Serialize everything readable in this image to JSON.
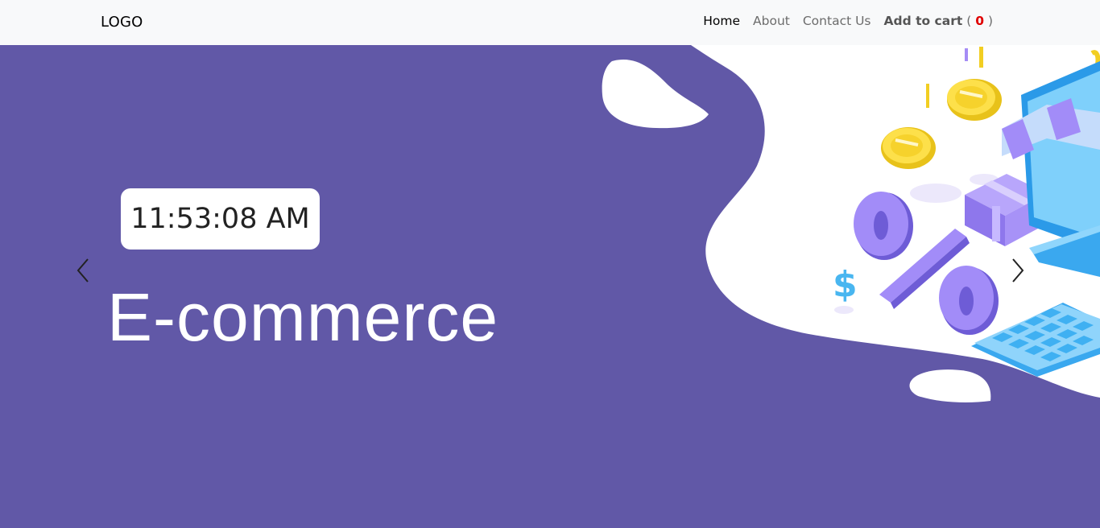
{
  "navbar": {
    "logo": "LOGO",
    "links": [
      {
        "label": "Home"
      },
      {
        "label": "About"
      },
      {
        "label": "Contact Us"
      }
    ],
    "cart": {
      "label": "Add to cart",
      "open": "(",
      "count": "0",
      "close": ")"
    }
  },
  "hero": {
    "clock": "11:53:08 AM",
    "title": "E-commerce",
    "prev_icon": "chevron-left-icon",
    "next_icon": "chevron-right-icon"
  },
  "colors": {
    "nav_bg": "#f8f9fa",
    "hero_bg": "#6158a7",
    "cart_count": "#e00000"
  }
}
